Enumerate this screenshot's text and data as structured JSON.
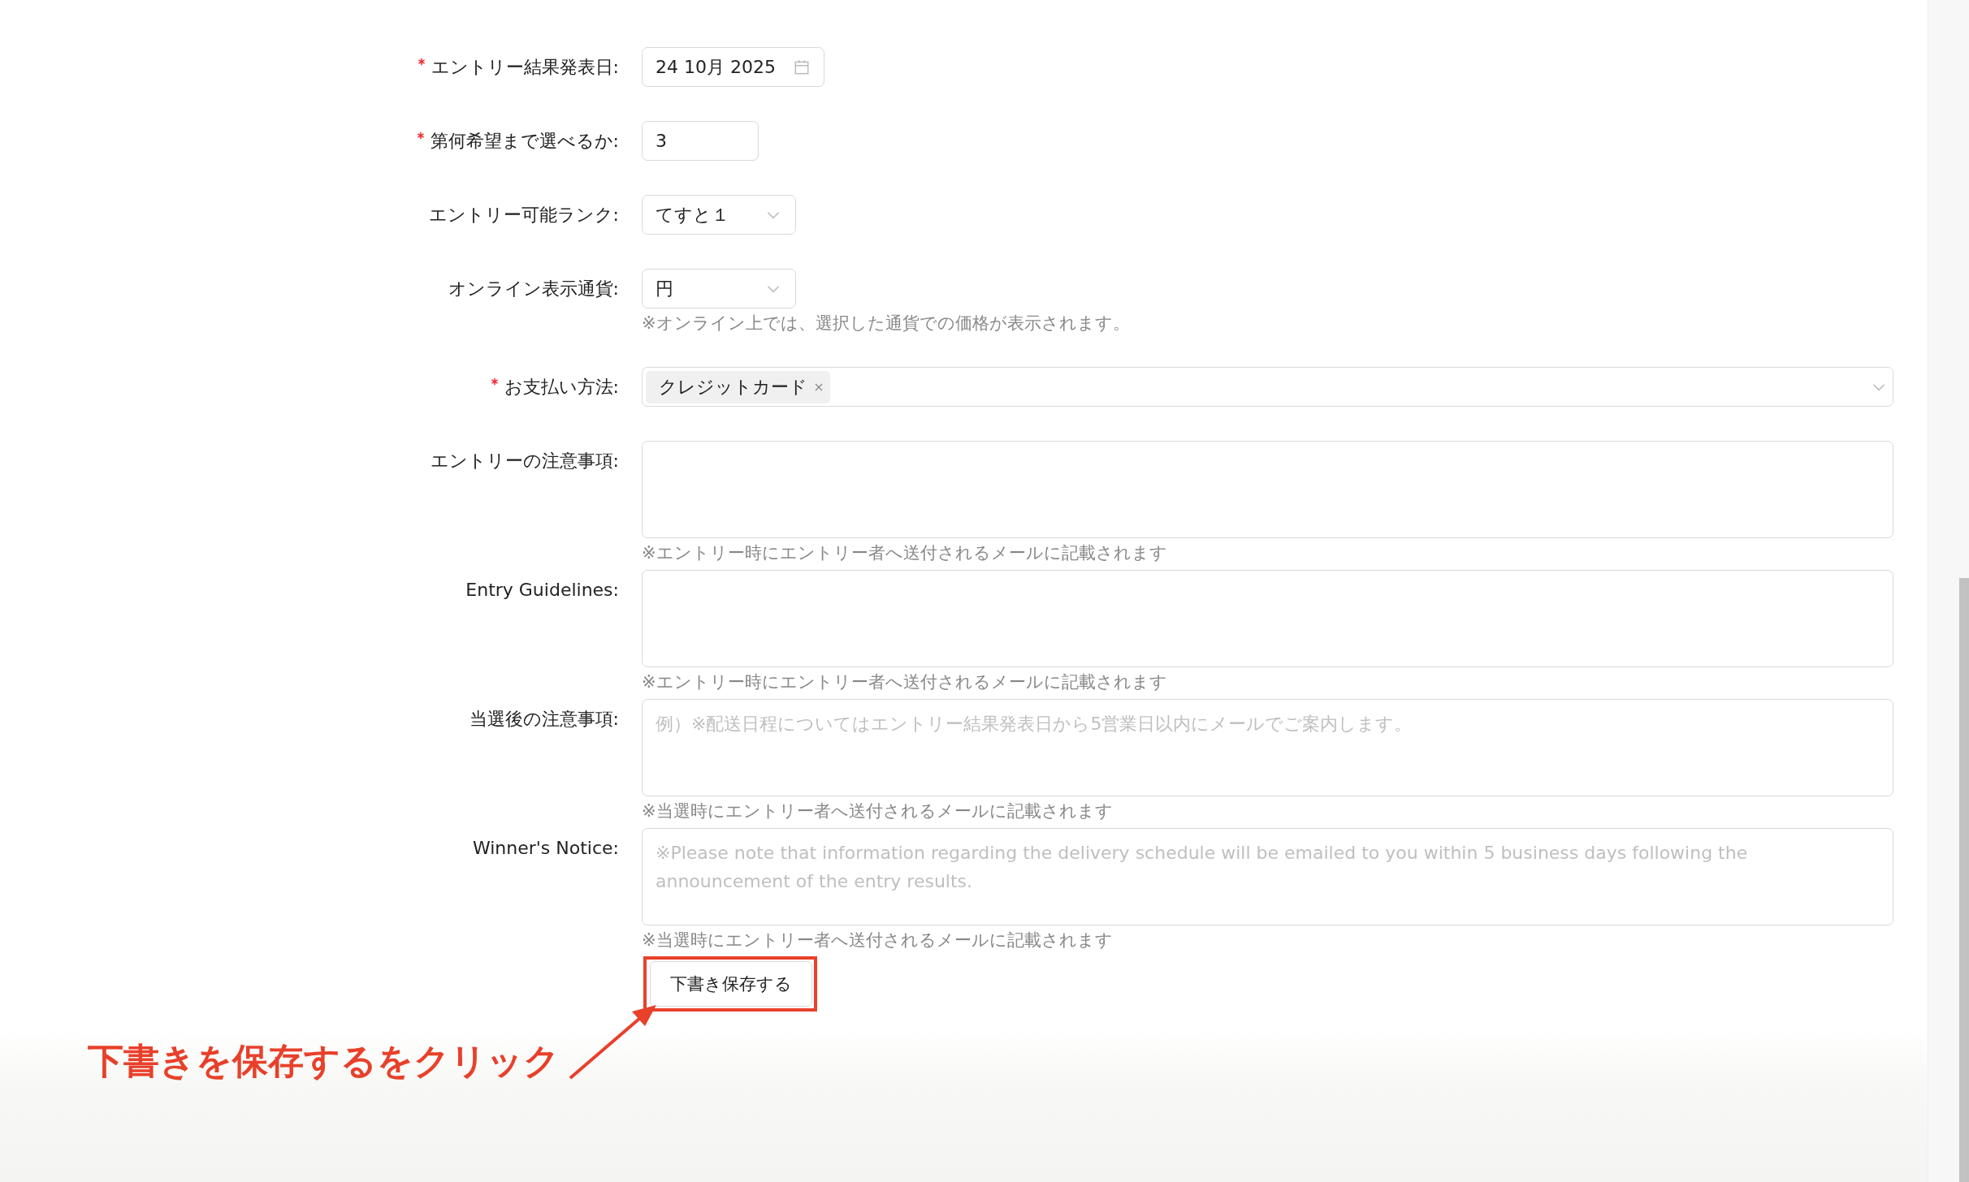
{
  "form": {
    "fields": [
      {
        "kind": "date",
        "label": "エントリー結果発表日:",
        "required": true,
        "value": "24 10月 2025"
      },
      {
        "kind": "number",
        "label": "第何希望まで選べるか:",
        "required": true,
        "value": "3"
      },
      {
        "kind": "select",
        "label": "エントリー可能ランク:",
        "required": false,
        "value": "てすと１"
      },
      {
        "kind": "select",
        "label": "オンライン表示通貨:",
        "required": false,
        "value": "円",
        "hint": "※オンライン上では、選択した通貨での価格が表示されます。"
      },
      {
        "kind": "tags",
        "label": "お支払い方法:",
        "required": true,
        "tags": [
          "クレジットカード"
        ]
      },
      {
        "kind": "textarea",
        "label": "エントリーの注意事項:",
        "required": false,
        "hint": "※エントリー時にエントリー者へ送付されるメールに記載されます"
      },
      {
        "kind": "textarea",
        "label": "Entry Guidelines:",
        "required": false,
        "hint": "※エントリー時にエントリー者へ送付されるメールに記載されます"
      },
      {
        "kind": "textarea",
        "label": "当選後の注意事項:",
        "required": false,
        "placeholder": "例）※配送日程についてはエントリー結果発表日から5営業日以内にメールでご案内します。",
        "hint": "※当選時にエントリー者へ送付されるメールに記載されます"
      },
      {
        "kind": "textarea",
        "label": "Winner's Notice:",
        "required": false,
        "placeholder": "※Please note that information regarding the delivery schedule will be emailed to you within 5 business days following the announcement of the entry results.",
        "hint": "※当選時にエントリー者へ送付されるメールに記載されます"
      }
    ],
    "save_button": "下書き保存する"
  },
  "annotation": {
    "text": "下書きを保存するをクリック"
  }
}
